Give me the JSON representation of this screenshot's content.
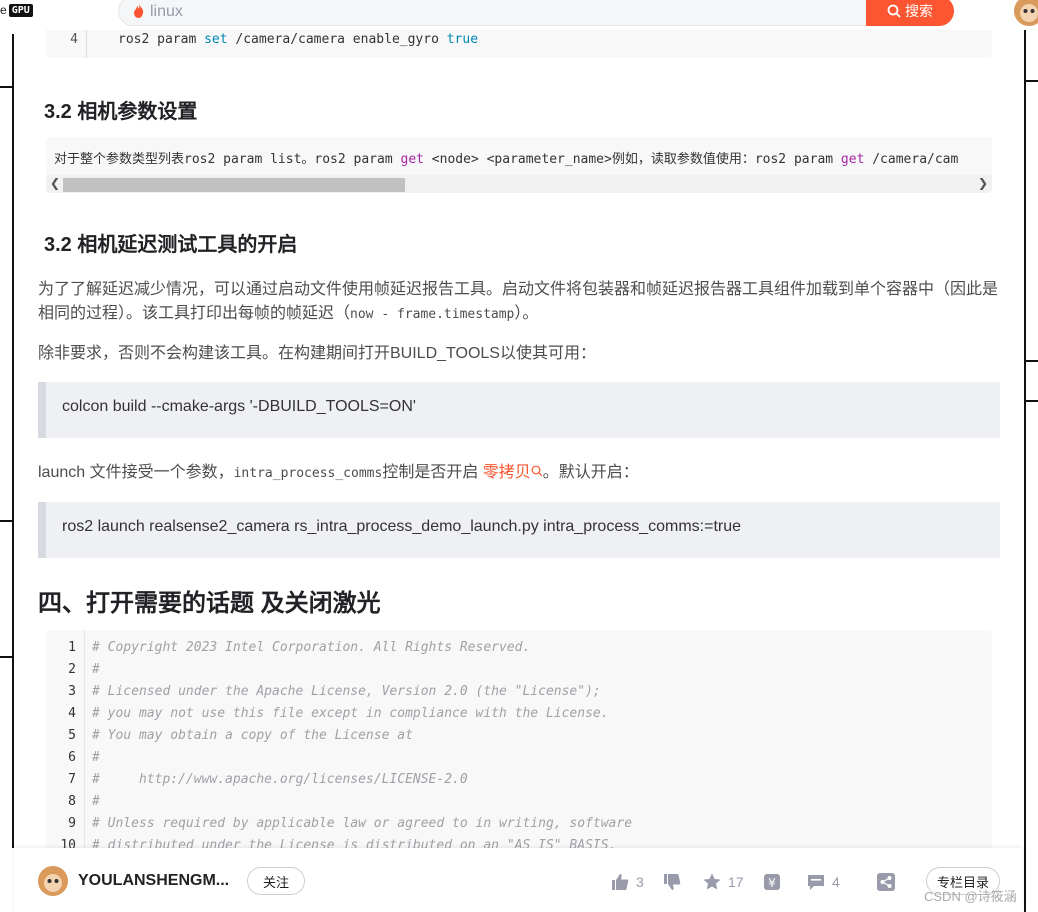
{
  "topbar": {
    "brand_prefix": "e",
    "gpu_badge": "GPU",
    "search_value": "linux",
    "search_button": "搜索",
    "flame_icon": "flame-icon",
    "search_icon": "search-icon"
  },
  "code_top": {
    "line_no": "4",
    "code_cmd": "ros2 param ",
    "code_kw": "set",
    "code_path": " /camera/camera enable_gyro ",
    "code_val": "true"
  },
  "section_32a": {
    "title": "3.2 相机参数设置"
  },
  "inline_code": {
    "pre": "对于整个参数类型列表ros2 param list。ros2 param ",
    "get1": "get",
    "mid": " <node> <parameter_name>例如，读取参数值使用：ros2 param ",
    "get2": "get",
    "post": " /camera/cam"
  },
  "section_32b": {
    "title": "3.2 相机延迟测试工具的开启"
  },
  "para1": {
    "line1": "为了了解延迟减少情况，可以通过启动文件使用帧延迟报告工具。启动文件将包装器和帧延迟报告器工具组件加载到单个容器中（因此是",
    "line2_pre": "相同的过程）。该工具打印出每帧的帧延迟（",
    "line2_code": "now - frame.timestamp",
    "line2_post": "）。"
  },
  "para2": {
    "text": "除非要求，否则不会构建该工具。在构建期间打开BUILD_TOOLS以使其可用："
  },
  "quote1": {
    "text": "colcon build --cmake-args '-DBUILD_TOOLS=ON'"
  },
  "para3": {
    "pre": "launch 文件接受一个参数，",
    "code": "intra_process_comms",
    "mid": "控制是否开启 ",
    "link": "零拷贝",
    "post": "。默认开启："
  },
  "quote2": {
    "text": "ros2 launch realsense2_camera rs_intra_process_demo_launch.py intra_process_comms:=true"
  },
  "section_4": {
    "title": "四、打开需要的话题 及关闭激光"
  },
  "codeblock": {
    "lines": [
      {
        "n": "1",
        "t": "# Copyright 2023 Intel Corporation. All Rights Reserved."
      },
      {
        "n": "2",
        "t": "#"
      },
      {
        "n": "3",
        "t": "# Licensed under the Apache License, Version 2.0 (the \"License\");"
      },
      {
        "n": "4",
        "t": "# you may not use this file except in compliance with the License."
      },
      {
        "n": "5",
        "t": "# You may obtain a copy of the License at"
      },
      {
        "n": "6",
        "t": "#"
      },
      {
        "n": "7",
        "t": "#     http://www.apache.org/licenses/LICENSE-2.0"
      },
      {
        "n": "8",
        "t": "#"
      },
      {
        "n": "9",
        "t": "# Unless required by applicable law or agreed to in writing, software"
      },
      {
        "n": "10",
        "t": "# distributed under the License is distributed on an \"AS IS\" BASIS,"
      }
    ]
  },
  "bottombar": {
    "author": "YOULANSHENGM...",
    "follow": "关注",
    "likes": "3",
    "favorites": "17",
    "comments": "4",
    "column_toc": "专栏目录",
    "watermark": "CSDN @诗筱涵"
  }
}
